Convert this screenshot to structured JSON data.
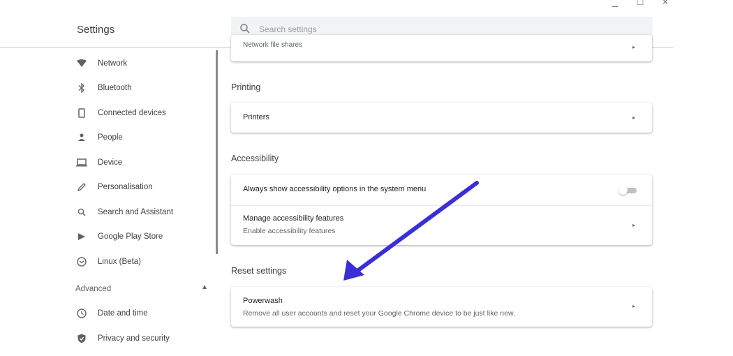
{
  "window_controls": {
    "minimize": "_",
    "maximize": "□",
    "close": "×"
  },
  "header": {
    "title": "Settings",
    "search": {
      "placeholder": "Search settings"
    }
  },
  "sidebar": {
    "items": [
      {
        "label": "Network",
        "icon": "wifi-icon"
      },
      {
        "label": "Bluetooth",
        "icon": "bluetooth-icon"
      },
      {
        "label": "Connected devices",
        "icon": "phone-icon"
      },
      {
        "label": "People",
        "icon": "person-icon"
      },
      {
        "label": "Device",
        "icon": "laptop-icon"
      },
      {
        "label": "Personalisation",
        "icon": "pen-icon"
      },
      {
        "label": "Search and Assistant",
        "icon": "search-icon"
      },
      {
        "label": "Google Play Store",
        "icon": "play-store-icon"
      },
      {
        "label": "Linux (Beta)",
        "icon": "linux-icon"
      }
    ],
    "advanced": {
      "label": "Advanced",
      "caret": "▲"
    },
    "advanced_items": [
      {
        "label": "Date and time",
        "icon": "clock-icon"
      },
      {
        "label": "Privacy and security",
        "icon": "shield-icon"
      }
    ]
  },
  "main": {
    "partial_row": {
      "label": "Network file shares",
      "arrow": "▸"
    },
    "printing": {
      "title": "Printing",
      "rows": [
        {
          "label": "Printers",
          "arrow": "▸"
        }
      ]
    },
    "accessibility": {
      "title": "Accessibility",
      "rows": [
        {
          "label": "Always show accessibility options in the system menu",
          "toggle": false
        },
        {
          "label": "Manage accessibility features",
          "sub": "Enable accessibility features",
          "arrow": "▸"
        }
      ]
    },
    "reset": {
      "title": "Reset settings",
      "rows": [
        {
          "label": "Powerwash",
          "sub": "Remove all user accounts and reset your Google Chrome device to be just like new.",
          "arrow": "▸"
        }
      ]
    }
  },
  "annotation": {
    "arrow_color": "#3a2fd6"
  }
}
